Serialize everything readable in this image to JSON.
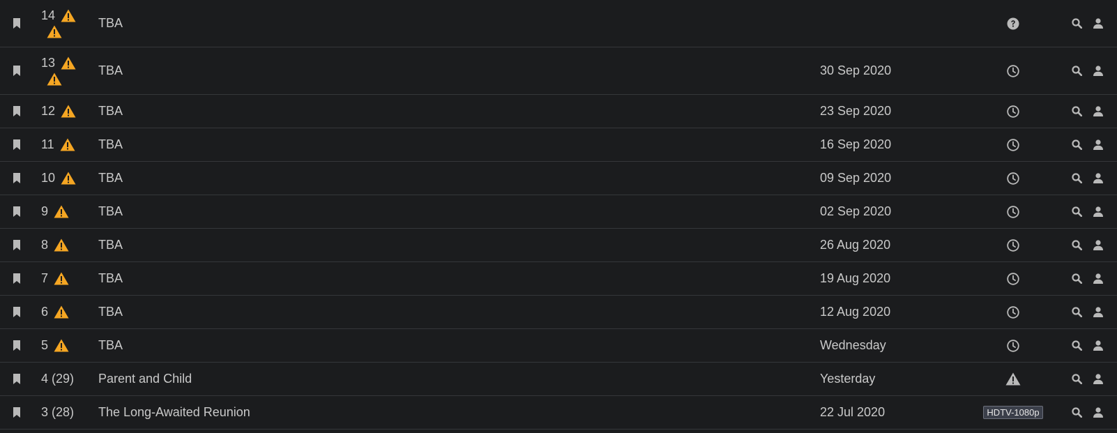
{
  "colors": {
    "background": "#1b1c1e",
    "divider": "#35373a",
    "text": "#c9c9c9",
    "icon": "#b9b9b9",
    "warning": "#f5a623"
  },
  "episodes": [
    {
      "episode": "14",
      "title": "TBA",
      "air_date": "",
      "status_icon": "question-circle-icon",
      "warnings": 2
    },
    {
      "episode": "13",
      "title": "TBA",
      "air_date": "30 Sep 2020",
      "status_icon": "clock-icon",
      "warnings": 2
    },
    {
      "episode": "12",
      "title": "TBA",
      "air_date": "23 Sep 2020",
      "status_icon": "clock-icon",
      "warnings": 1
    },
    {
      "episode": "11",
      "title": "TBA",
      "air_date": "16 Sep 2020",
      "status_icon": "clock-icon",
      "warnings": 1
    },
    {
      "episode": "10",
      "title": "TBA",
      "air_date": "09 Sep 2020",
      "status_icon": "clock-icon",
      "warnings": 1
    },
    {
      "episode": "9",
      "title": "TBA",
      "air_date": "02 Sep 2020",
      "status_icon": "clock-icon",
      "warnings": 1
    },
    {
      "episode": "8",
      "title": "TBA",
      "air_date": "26 Aug 2020",
      "status_icon": "clock-icon",
      "warnings": 1
    },
    {
      "episode": "7",
      "title": "TBA",
      "air_date": "19 Aug 2020",
      "status_icon": "clock-icon",
      "warnings": 1
    },
    {
      "episode": "6",
      "title": "TBA",
      "air_date": "12 Aug 2020",
      "status_icon": "clock-icon",
      "warnings": 1
    },
    {
      "episode": "5",
      "title": "TBA",
      "air_date": "Wednesday",
      "status_icon": "clock-icon",
      "warnings": 1
    },
    {
      "episode": "4 (29)",
      "title": "Parent and Child",
      "air_date": "Yesterday",
      "status_icon": "warning-icon",
      "warnings": 0
    },
    {
      "episode": "3 (28)",
      "title": "The Long-Awaited Reunion",
      "air_date": "22 Jul 2020",
      "status_icon": "",
      "status_badge": "HDTV-1080p",
      "warnings": 0
    }
  ]
}
